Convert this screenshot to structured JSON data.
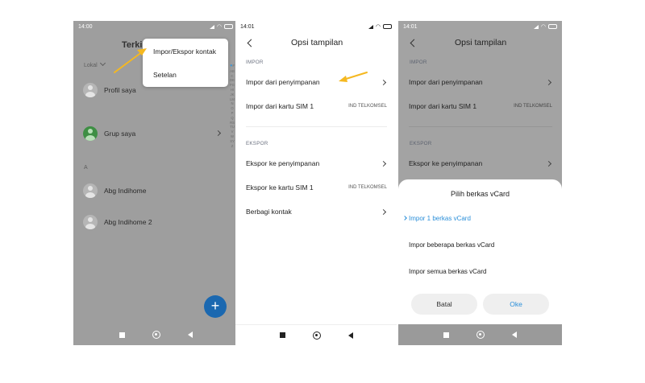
{
  "colors": {
    "accent_arrow": "#f5b820",
    "selected_blue": "#2b8fd9",
    "fab_blue": "#1b68b0",
    "group_green": "#3e8f44"
  },
  "panel1": {
    "time": "14:00",
    "title": "Terkini",
    "group_selector": "Lokal",
    "profile": "Profil saya",
    "group": "Grup saya",
    "section_letter": "A",
    "contacts": [
      "Abg Indihome",
      "Abg Indihome 2"
    ],
    "alpha_index": "#ABCDEFGHIJKLMNOPQRSTUVWXYZ",
    "fab_symbol": "+",
    "menu": {
      "import_export": "Impor/Ekspor kontak",
      "settings": "Setelan"
    }
  },
  "panel2": {
    "time": "14:01",
    "title": "Opsi tampilan",
    "import_section": "IMPOR",
    "import_storage": "Impor dari penyimpanan",
    "import_sim": "Impor dari kartu SIM 1",
    "sim_carrier": "IND TELKOMSEL",
    "export_section": "EKSPOR",
    "export_storage": "Ekspor ke penyimpanan",
    "export_sim": "Ekspor ke kartu SIM 1",
    "export_sim_carrier": "IND TELKOMSEL",
    "share": "Berbagi kontak"
  },
  "panel3": {
    "time": "14:01",
    "title": "Opsi tampilan",
    "import_section": "IMPOR",
    "import_storage": "Impor dari penyimpanan",
    "import_sim": "Impor dari kartu SIM 1",
    "sim_carrier": "IND TELKOMSEL",
    "export_section": "EKSPOR",
    "export_storage": "Ekspor ke penyimpanan",
    "dialog": {
      "title": "Pilih berkas vCard",
      "options": [
        "Impor 1 berkas vCard",
        "Impor beberapa berkas vCard",
        "Impor semua berkas vCard"
      ],
      "cancel": "Batal",
      "ok": "Oke"
    }
  }
}
